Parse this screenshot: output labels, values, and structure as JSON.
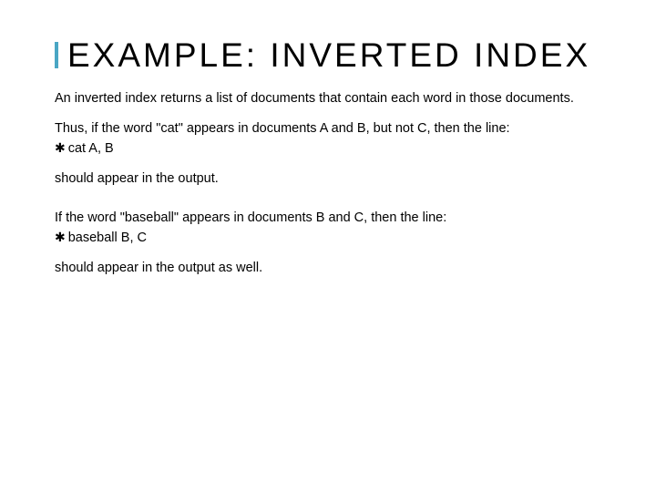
{
  "title": "EXAMPLE: INVERTED INDEX",
  "p1": "An inverted index returns a list of documents that contain each word in those documents.",
  "p2": "Thus, if the word \"cat\" appears in documents A and B, but not C, then the line:",
  "b1": "cat A, B",
  "p3": "should appear in the output.",
  "p4": "If the word \"baseball\" appears in documents B and C, then the line:",
  "b2": "baseball B, C",
  "p5": "should appear in the output as well.",
  "bullet_glyph": "✱"
}
